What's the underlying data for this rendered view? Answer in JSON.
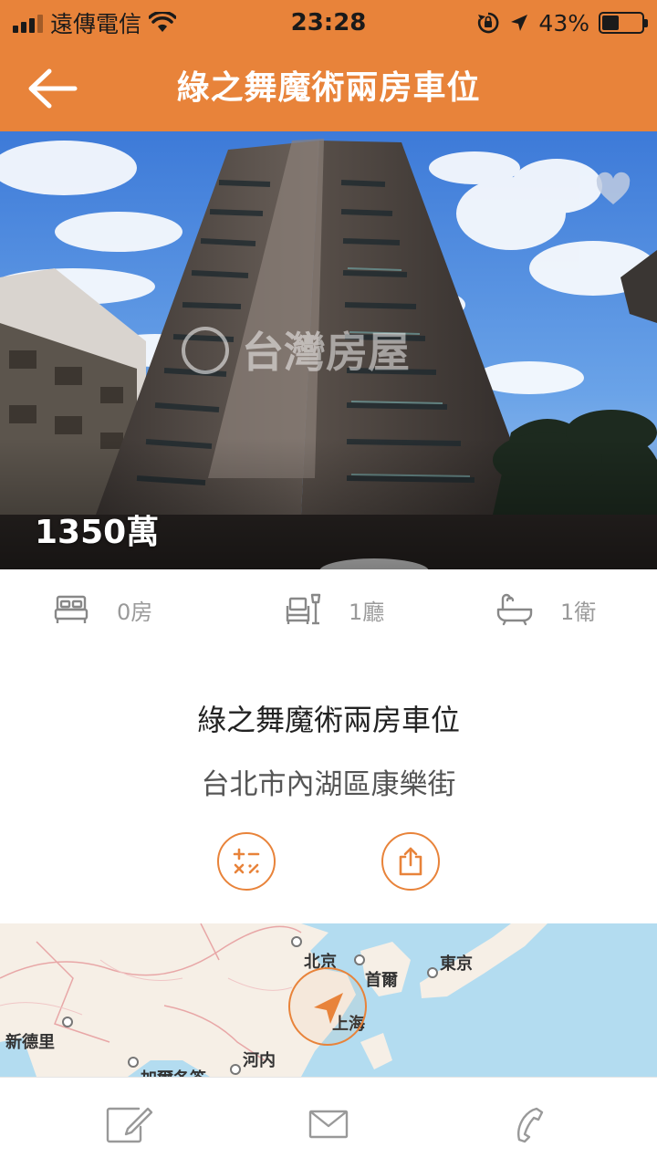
{
  "status_bar": {
    "carrier": "遠傳電信",
    "time": "23:28",
    "battery": "43%",
    "battery_level": 0.43,
    "signal_bars": 3
  },
  "nav": {
    "title": "綠之舞魔術兩房車位",
    "back_icon": "back-arrow-icon"
  },
  "listing": {
    "price": "1350萬",
    "watermark": "台灣房屋",
    "favorite_icon": "heart-icon",
    "features": [
      {
        "icon": "bed-icon",
        "label": "0房"
      },
      {
        "icon": "sofa-lamp-icon",
        "label": "1廳"
      },
      {
        "icon": "bathtub-icon",
        "label": "1衛"
      }
    ],
    "title": "綠之舞魔術兩房車位",
    "address": "台北市內湖區康樂街"
  },
  "actions": {
    "calculator_icon": "calculator-icon",
    "share_icon": "share-icon"
  },
  "map": {
    "labels": [
      "北京",
      "首爾",
      "東京",
      "上海",
      "新德里",
      "河内",
      "加爾各答"
    ]
  },
  "toolbar": {
    "icons": [
      "edit-note-icon",
      "mail-icon",
      "phone-icon"
    ]
  },
  "colors": {
    "accent": "#e8833a",
    "text_dark": "#222222",
    "text_muted": "#9a9a9a",
    "sea": "#b3dcf0",
    "land": "#f6efe6"
  }
}
